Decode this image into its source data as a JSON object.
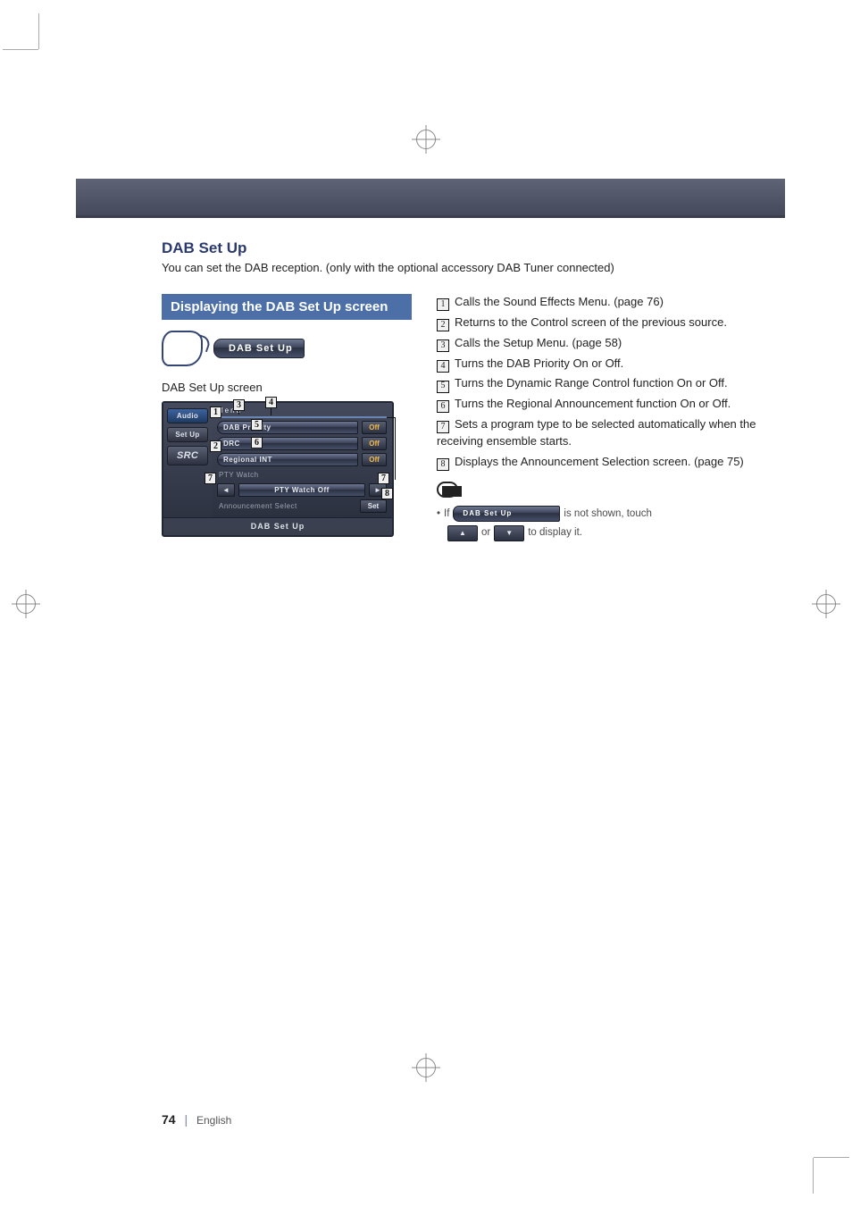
{
  "page": {
    "number": "74",
    "language": "English"
  },
  "section": {
    "title": "DAB Set Up",
    "desc": "You can set the DAB reception. (only with the optional accessory DAB Tuner connected)"
  },
  "box": {
    "title": "Displaying the DAB Set Up screen"
  },
  "touch": {
    "pill": "DAB Set Up"
  },
  "caption": "DAB Set Up screen",
  "device": {
    "side": {
      "audio": "Audio",
      "setup": "Set Up",
      "src": "SRC"
    },
    "menu_hdr": "Menu",
    "rows": {
      "priority": {
        "label": "DAB Priority",
        "value": "Off"
      },
      "drc": {
        "label": "DRC",
        "value": "Off"
      },
      "regional": {
        "label": "Regional INT",
        "value": "Off"
      },
      "pty_h": {
        "label": "PTY Watch"
      },
      "pty": {
        "label": "PTY Watch Off"
      },
      "ann": {
        "label": "Announcement Select",
        "btn": "Set"
      }
    },
    "footer": "DAB Set Up"
  },
  "callouts": {
    "c1": "1",
    "c2": "2",
    "c3": "3",
    "c4": "4",
    "c5": "5",
    "c6": "6",
    "c7l": "7",
    "c7r": "7",
    "c8": "8"
  },
  "notes": {
    "n1": {
      "num": "1",
      "text": "Calls the Sound Effects Menu. (page 76)"
    },
    "n2": {
      "num": "2",
      "text": "Returns to the Control screen of the previous source."
    },
    "n3": {
      "num": "3",
      "text": "Calls the Setup Menu. (page 58)"
    },
    "n4": {
      "num": "4",
      "text": "Turns the DAB Priority On or Off."
    },
    "n5": {
      "num": "5",
      "text": "Turns the Dynamic Range Control function On or Off."
    },
    "n6": {
      "num": "6",
      "text": "Turns the Regional Announcement function On or Off."
    },
    "n7": {
      "num": "7",
      "text": "Sets a program type to be selected automatically when the receiving ensemble starts."
    },
    "n8": {
      "num": "8",
      "text": "Displays the Announcement Selection screen. (page 75)"
    }
  },
  "footnote": {
    "bullet": "•",
    "if": "If",
    "pill": "DAB Set Up",
    "after_pill": "is not shown, touch",
    "or": "or",
    "tail": "to display it.",
    "up": "▲",
    "down": "▼"
  }
}
